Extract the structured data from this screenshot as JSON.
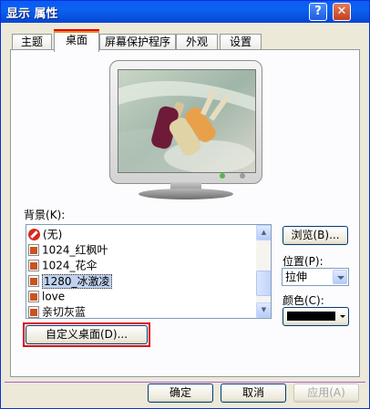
{
  "window": {
    "title": "显示 属性"
  },
  "titlebar": {
    "help_glyph": "?",
    "close_glyph": "✕"
  },
  "tabs": [
    {
      "label": "主题"
    },
    {
      "label": "桌面"
    },
    {
      "label": "屏幕保护程序"
    },
    {
      "label": "外观"
    },
    {
      "label": "设置"
    }
  ],
  "active_tab": "桌面",
  "preview": {
    "wallpaper": "1280_冰激凌",
    "description": "popsicle wallpaper preview on monitor"
  },
  "background": {
    "label_text": "背景",
    "label_accel": "(K):",
    "items": [
      {
        "label": "(无)",
        "icon": "none-icon"
      },
      {
        "label": "1024_红枫叶",
        "icon": "image-file-icon"
      },
      {
        "label": "1024_花伞",
        "icon": "image-file-icon"
      },
      {
        "label": "1280_冰激凌",
        "icon": "image-file-icon"
      },
      {
        "label": "love",
        "icon": "image-file-icon"
      },
      {
        "label": "亲切灰蓝",
        "icon": "image-file-icon"
      }
    ],
    "selected": "1280_冰激凌"
  },
  "buttons": {
    "browse": "浏览(B)...",
    "customize_desktop": "自定义桌面(D)...",
    "ok": "确定",
    "cancel": "取消",
    "apply": "应用(A)"
  },
  "position": {
    "label": "位置(P):",
    "value": "拉伸"
  },
  "color": {
    "label": "颜色(C):",
    "value": "#000000"
  },
  "colors": {
    "titlebar": "#0a5bf5",
    "highlight": "#e00000",
    "separator": "#b35bd3"
  }
}
